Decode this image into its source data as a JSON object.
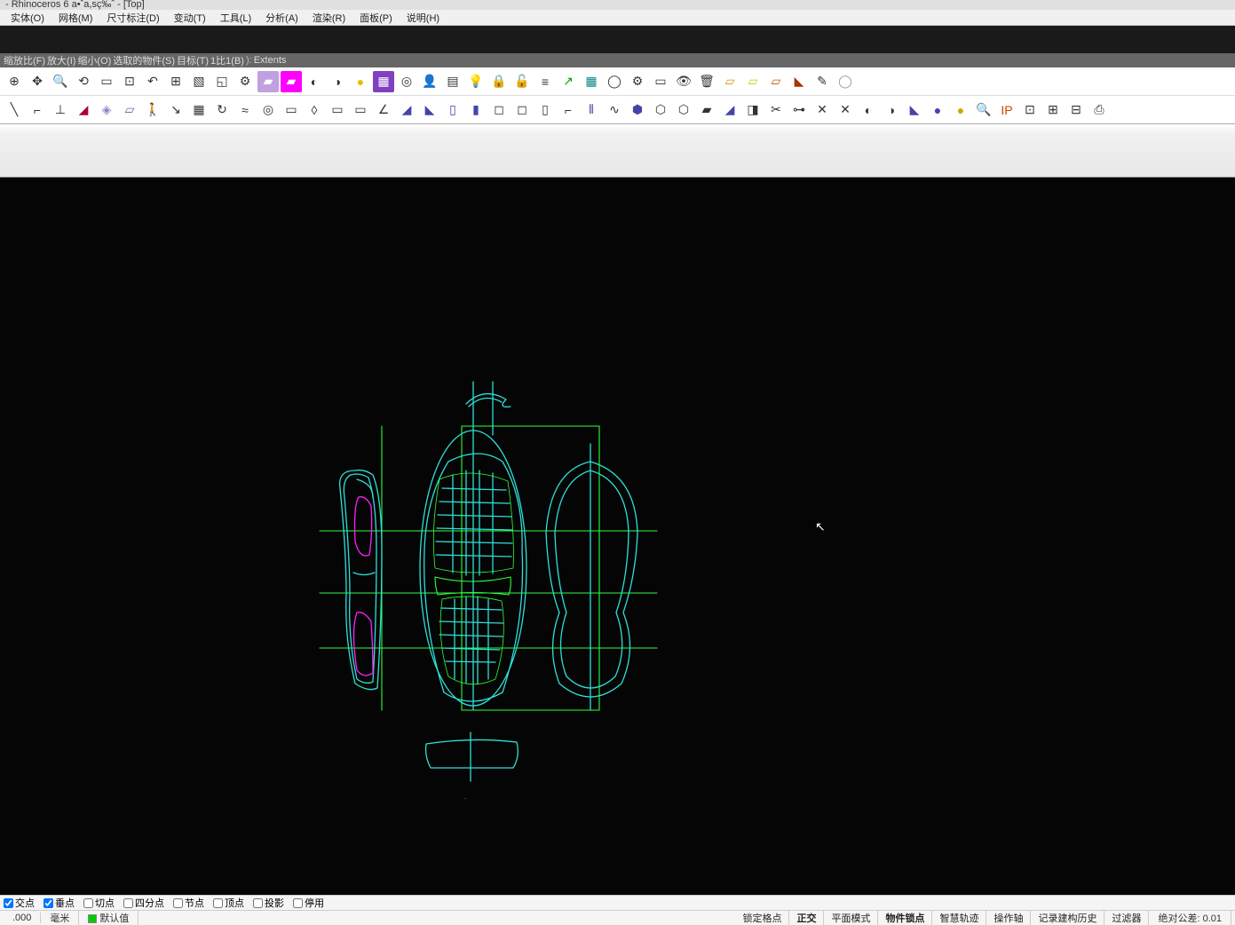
{
  "title": "- Rhinoceros 6 a•ˆa,sç‰ˆ  - [Top]",
  "menu": [
    "实体(O)",
    "网格(M)",
    "尺寸标注(D)",
    "变动(T)",
    "工具(L)",
    "分析(A)",
    "渲染(R)",
    "面板(P)",
    "说明(H)"
  ],
  "prompt": {
    "options": [
      "缩放比(F)",
      "放大(I)",
      "缩小(O)",
      "选取的物件(S)",
      "目标(T)",
      "1比1(B)"
    ],
    "sep": " ): ",
    "value": "Extents"
  },
  "toolbar1": [
    {
      "name": "pan-icon",
      "g": "⊕"
    },
    {
      "name": "move-icon",
      "g": "✥"
    },
    {
      "name": "zoom-icon",
      "g": "🔍"
    },
    {
      "name": "zoom-dynamic-icon",
      "g": "⟲"
    },
    {
      "name": "zoom-window-icon",
      "g": "▭"
    },
    {
      "name": "zoom-extents-icon",
      "g": "⊡"
    },
    {
      "name": "undo-view-icon",
      "g": "↶"
    },
    {
      "name": "4view-icon",
      "g": "⊞"
    },
    {
      "name": "cplane-icon",
      "g": "▧"
    },
    {
      "name": "set-view-icon",
      "g": "◱"
    },
    {
      "name": "gumball-icon",
      "g": "⚙"
    },
    {
      "name": "shade-icon",
      "g": "▰",
      "bg": "#c0a0e0"
    },
    {
      "name": "shade-sel-icon",
      "g": "▰",
      "bg": "#ff00ff"
    },
    {
      "name": "render-icon",
      "g": "◐"
    },
    {
      "name": "render-preview-icon",
      "g": "◑"
    },
    {
      "name": "render-mesh-icon",
      "g": "●",
      "c": "#e0c000"
    },
    {
      "name": "texture-icon",
      "g": "▦",
      "bg": "#8040c0"
    },
    {
      "name": "hide-icon",
      "g": "◎"
    },
    {
      "name": "show-icon",
      "g": "👤"
    },
    {
      "name": "sel-filter-icon",
      "g": "▤"
    },
    {
      "name": "light-icon",
      "g": "💡"
    },
    {
      "name": "lock-icon",
      "g": "🔒"
    },
    {
      "name": "unlock-icon",
      "g": "🔓"
    },
    {
      "name": "layer-icon",
      "g": "≡"
    },
    {
      "name": "layer-on-icon",
      "g": "↗",
      "c": "#0a0"
    },
    {
      "name": "edit-layer-icon",
      "g": "▦",
      "c": "#088"
    },
    {
      "name": "globe-icon",
      "g": "◯"
    },
    {
      "name": "properties-icon",
      "g": "⚙"
    },
    {
      "name": "named-view-icon",
      "g": "▭"
    },
    {
      "name": "camera-icon",
      "g": "👁"
    },
    {
      "name": "trash-icon",
      "g": "🗑"
    },
    {
      "name": "export-icon",
      "g": "▱",
      "c": "#c90"
    },
    {
      "name": "import-icon",
      "g": "▱",
      "c": "#cc0"
    },
    {
      "name": "import2-icon",
      "g": "▱",
      "c": "#c50"
    },
    {
      "name": "paint-icon",
      "g": "◣",
      "c": "#a30"
    },
    {
      "name": "pen-icon",
      "g": "✎"
    },
    {
      "name": "color-wheel-icon",
      "g": "◯",
      "c": "#999"
    }
  ],
  "toolbar2": [
    {
      "name": "line-icon",
      "g": "╲"
    },
    {
      "name": "polyline-icon",
      "g": "⌐"
    },
    {
      "name": "perp-icon",
      "g": "⊥"
    },
    {
      "name": "ribbon-icon",
      "g": "◢",
      "c": "#a04"
    },
    {
      "name": "tag-icon",
      "g": "◈",
      "c": "#88c"
    },
    {
      "name": "extrude-icon",
      "g": "▱",
      "c": "#66a"
    },
    {
      "name": "person-icon",
      "g": "🚶"
    },
    {
      "name": "leader-icon",
      "g": "↘"
    },
    {
      "name": "grid-icon",
      "g": "▦"
    },
    {
      "name": "history-icon",
      "g": "↻"
    },
    {
      "name": "wave-icon",
      "g": "≈"
    },
    {
      "name": "ring-icon",
      "g": "◎"
    },
    {
      "name": "cylinder-icon",
      "g": "▭"
    },
    {
      "name": "eraser-icon",
      "g": "◊"
    },
    {
      "name": "dim-icon",
      "g": "▭"
    },
    {
      "name": "dim2-icon",
      "g": "▭"
    },
    {
      "name": "angle-icon",
      "g": "∠"
    },
    {
      "name": "sweep-icon",
      "g": "◢",
      "c": "#44a"
    },
    {
      "name": "sweep2-icon",
      "g": "◣",
      "c": "#44a"
    },
    {
      "name": "box-icon",
      "g": "▯",
      "c": "#44a"
    },
    {
      "name": "box2-icon",
      "g": "▮",
      "c": "#44a"
    },
    {
      "name": "boxopen-icon",
      "g": "◻"
    },
    {
      "name": "boxclosed-icon",
      "g": "◻"
    },
    {
      "name": "paper-icon",
      "g": "▯"
    },
    {
      "name": "corner-icon",
      "g": "⌐"
    },
    {
      "name": "array-icon",
      "g": "⫴",
      "c": "#44a"
    },
    {
      "name": "wavy-icon",
      "g": "∿"
    },
    {
      "name": "hex-icon",
      "g": "⬢",
      "c": "#44a"
    },
    {
      "name": "hex2-icon",
      "g": "⬡"
    },
    {
      "name": "hex3-icon",
      "g": "⬡"
    },
    {
      "name": "morph-icon",
      "g": "▰"
    },
    {
      "name": "morph2-icon",
      "g": "◢",
      "c": "#44a"
    },
    {
      "name": "split-icon",
      "g": "◨"
    },
    {
      "name": "cut-icon",
      "g": "✂"
    },
    {
      "name": "join-icon",
      "g": "⊶"
    },
    {
      "name": "cross-icon",
      "g": "✕"
    },
    {
      "name": "cross2-icon",
      "g": "✕"
    },
    {
      "name": "bool-icon",
      "g": "◐"
    },
    {
      "name": "bool2-icon",
      "g": "◑"
    },
    {
      "name": "blend-icon",
      "g": "◣",
      "c": "#44a"
    },
    {
      "name": "sphere-icon",
      "g": "●",
      "c": "#44a"
    },
    {
      "name": "sphere2-icon",
      "g": "●",
      "c": "#ca0"
    },
    {
      "name": "zoom2-icon",
      "g": "🔍"
    },
    {
      "name": "ip-icon",
      "g": "IP",
      "c": "#c40"
    },
    {
      "name": "node-icon",
      "g": "⊡"
    },
    {
      "name": "node2-icon",
      "g": "⊞"
    },
    {
      "name": "node3-icon",
      "g": "⊟"
    },
    {
      "name": "print-icon",
      "g": "⎙"
    }
  ],
  "osnap": [
    {
      "label": "交点",
      "checked": true
    },
    {
      "label": "垂点",
      "checked": true
    },
    {
      "label": "切点",
      "checked": false
    },
    {
      "label": "四分点",
      "checked": false
    },
    {
      "label": "节点",
      "checked": false
    },
    {
      "label": "顶点",
      "checked": false
    },
    {
      "label": "投影",
      "checked": false
    },
    {
      "label": "停用",
      "checked": false
    }
  ],
  "status": {
    "coord": ".000",
    "unit": "毫米",
    "layer": "默认值",
    "toggles": [
      "锁定格点",
      "正交",
      "平面模式",
      "物件锁点",
      "智慧轨迹",
      "操作轴",
      "记录建构历史",
      "过滤器"
    ],
    "active_toggles": [
      1,
      3
    ],
    "tolerance": "绝对公差: 0.01"
  }
}
